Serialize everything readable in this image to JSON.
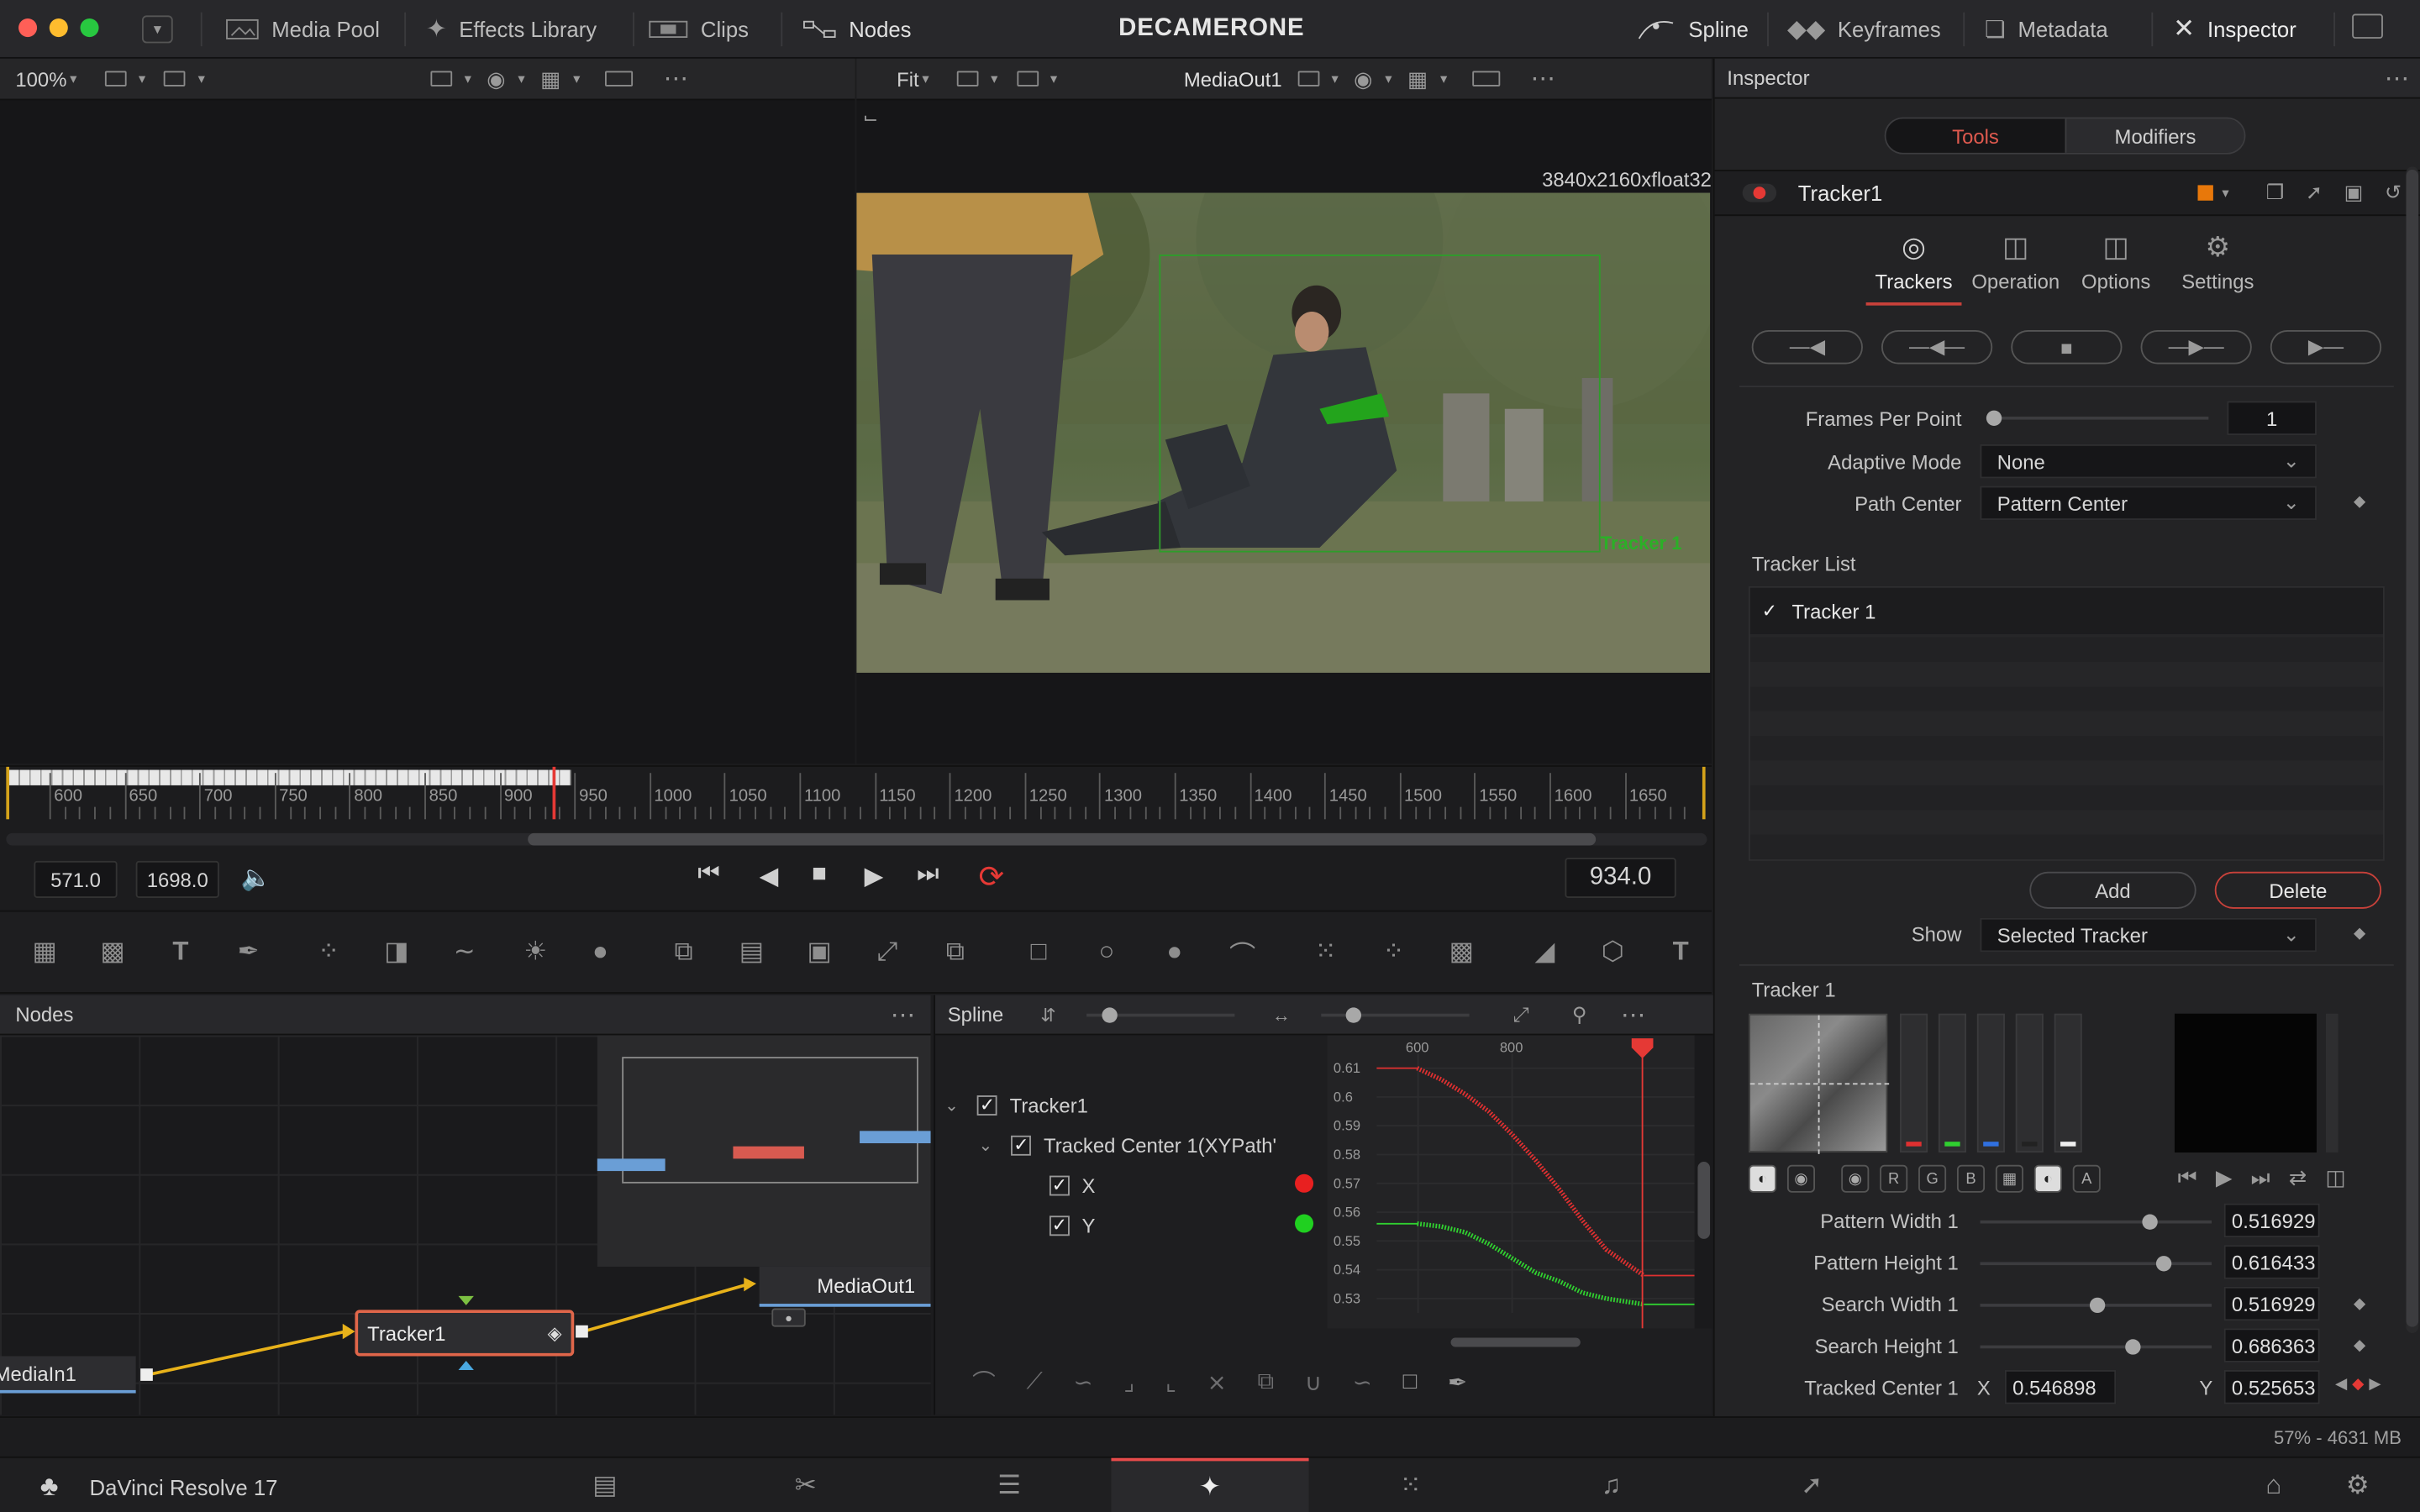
{
  "window": {
    "title": "DECAMERONE",
    "traffic_lights": [
      "#ff5f57",
      "#febc2e",
      "#28c840"
    ]
  },
  "topbar": {
    "media_pool": "Media Pool",
    "effects_library": "Effects Library",
    "clips": "Clips",
    "nodes": "Nodes",
    "spline": "Spline",
    "keyframes": "Keyframes",
    "metadata": "Metadata",
    "inspector": "Inspector"
  },
  "viewer_left": {
    "zoom": "100%"
  },
  "viewer_right": {
    "fit": "Fit",
    "output_name": "MediaOut1",
    "resolution": "3840x2160xfloat32",
    "tracker_label": "Tracker 1"
  },
  "timeline": {
    "ticks": [
      "600",
      "650",
      "700",
      "750",
      "800",
      "850",
      "900",
      "950",
      "1000",
      "1050",
      "1100",
      "1150",
      "1200",
      "1250",
      "1300",
      "1350",
      "1400",
      "1450",
      "1500",
      "1550",
      "1600",
      "1650"
    ],
    "playhead_frame": 934
  },
  "transport": {
    "start": "571.0",
    "end": "1698.0",
    "current": "934.0"
  },
  "nodes_panel": {
    "title": "Nodes",
    "nodes": {
      "media_in": "MediaIn1",
      "tracker": "Tracker1",
      "media_out": "MediaOut1"
    }
  },
  "spline_panel": {
    "title": "Spline",
    "tree": {
      "tracker": "Tracker1",
      "tracked_center": "Tracked Center 1(XYPath'",
      "x": "X",
      "y": "Y"
    },
    "chart_data": {
      "type": "line",
      "x_ticks": [
        "600",
        "800"
      ],
      "y_ticks": [
        "0.61",
        "0.6",
        "0.59",
        "0.58",
        "0.57",
        "0.56",
        "0.55",
        "0.54",
        "0.53"
      ],
      "ylim": [
        0.525,
        0.615
      ],
      "xlim": [
        512,
        1188
      ],
      "playhead_x": 1077,
      "series": [
        {
          "name": "X",
          "color": "#e03030",
          "x": [
            598,
            650,
            700,
            750,
            800,
            850,
            900,
            950,
            1000,
            1080
          ],
          "y": [
            0.61,
            0.606,
            0.601,
            0.595,
            0.587,
            0.578,
            0.568,
            0.557,
            0.547,
            0.538
          ]
        },
        {
          "name": "Y",
          "color": "#30d030",
          "x": [
            598,
            650,
            700,
            750,
            800,
            850,
            900,
            950,
            1000,
            1080
          ],
          "y": [
            0.556,
            0.555,
            0.553,
            0.549,
            0.544,
            0.539,
            0.536,
            0.532,
            0.53,
            0.528
          ]
        }
      ]
    }
  },
  "inspector": {
    "title": "Inspector",
    "tabs": {
      "tools": "Tools",
      "modifiers": "Modifiers"
    },
    "node_name": "Tracker1",
    "subtabs": {
      "trackers": "Trackers",
      "operation": "Operation",
      "options": "Options",
      "settings": "Settings"
    },
    "frames_per_point": {
      "label": "Frames Per Point",
      "value": "1",
      "level": 0.0
    },
    "adaptive_mode": {
      "label": "Adaptive Mode",
      "value": "None"
    },
    "path_center": {
      "label": "Path Center",
      "value": "Pattern Center"
    },
    "tracker_list": {
      "label": "Tracker List",
      "items": [
        "Tracker 1"
      ]
    },
    "add": "Add",
    "delete": "Delete",
    "show": {
      "label": "Show",
      "value": "Selected Tracker"
    },
    "tracker_section": "Tracker 1",
    "channel_buttons": [
      "R",
      "G",
      "B",
      "A"
    ],
    "pattern_width": {
      "label": "Pattern Width 1",
      "value": "0.516929"
    },
    "pattern_height": {
      "label": "Pattern Height 1",
      "value": "0.616433"
    },
    "search_width": {
      "label": "Search Width 1",
      "value": "0.516929"
    },
    "search_height": {
      "label": "Search Height 1",
      "value": "0.686363"
    },
    "tracked_center": {
      "label": "Tracked Center 1",
      "x_label": "X",
      "x_value": "0.546898",
      "y_label": "Y",
      "y_value": "0.525653"
    }
  },
  "statusbar": {
    "memory": "57% - 4631 MB"
  },
  "bottombar": {
    "app_name": "DaVinci Resolve 17",
    "active_page": "fusion",
    "accent": "#e64b4b"
  }
}
